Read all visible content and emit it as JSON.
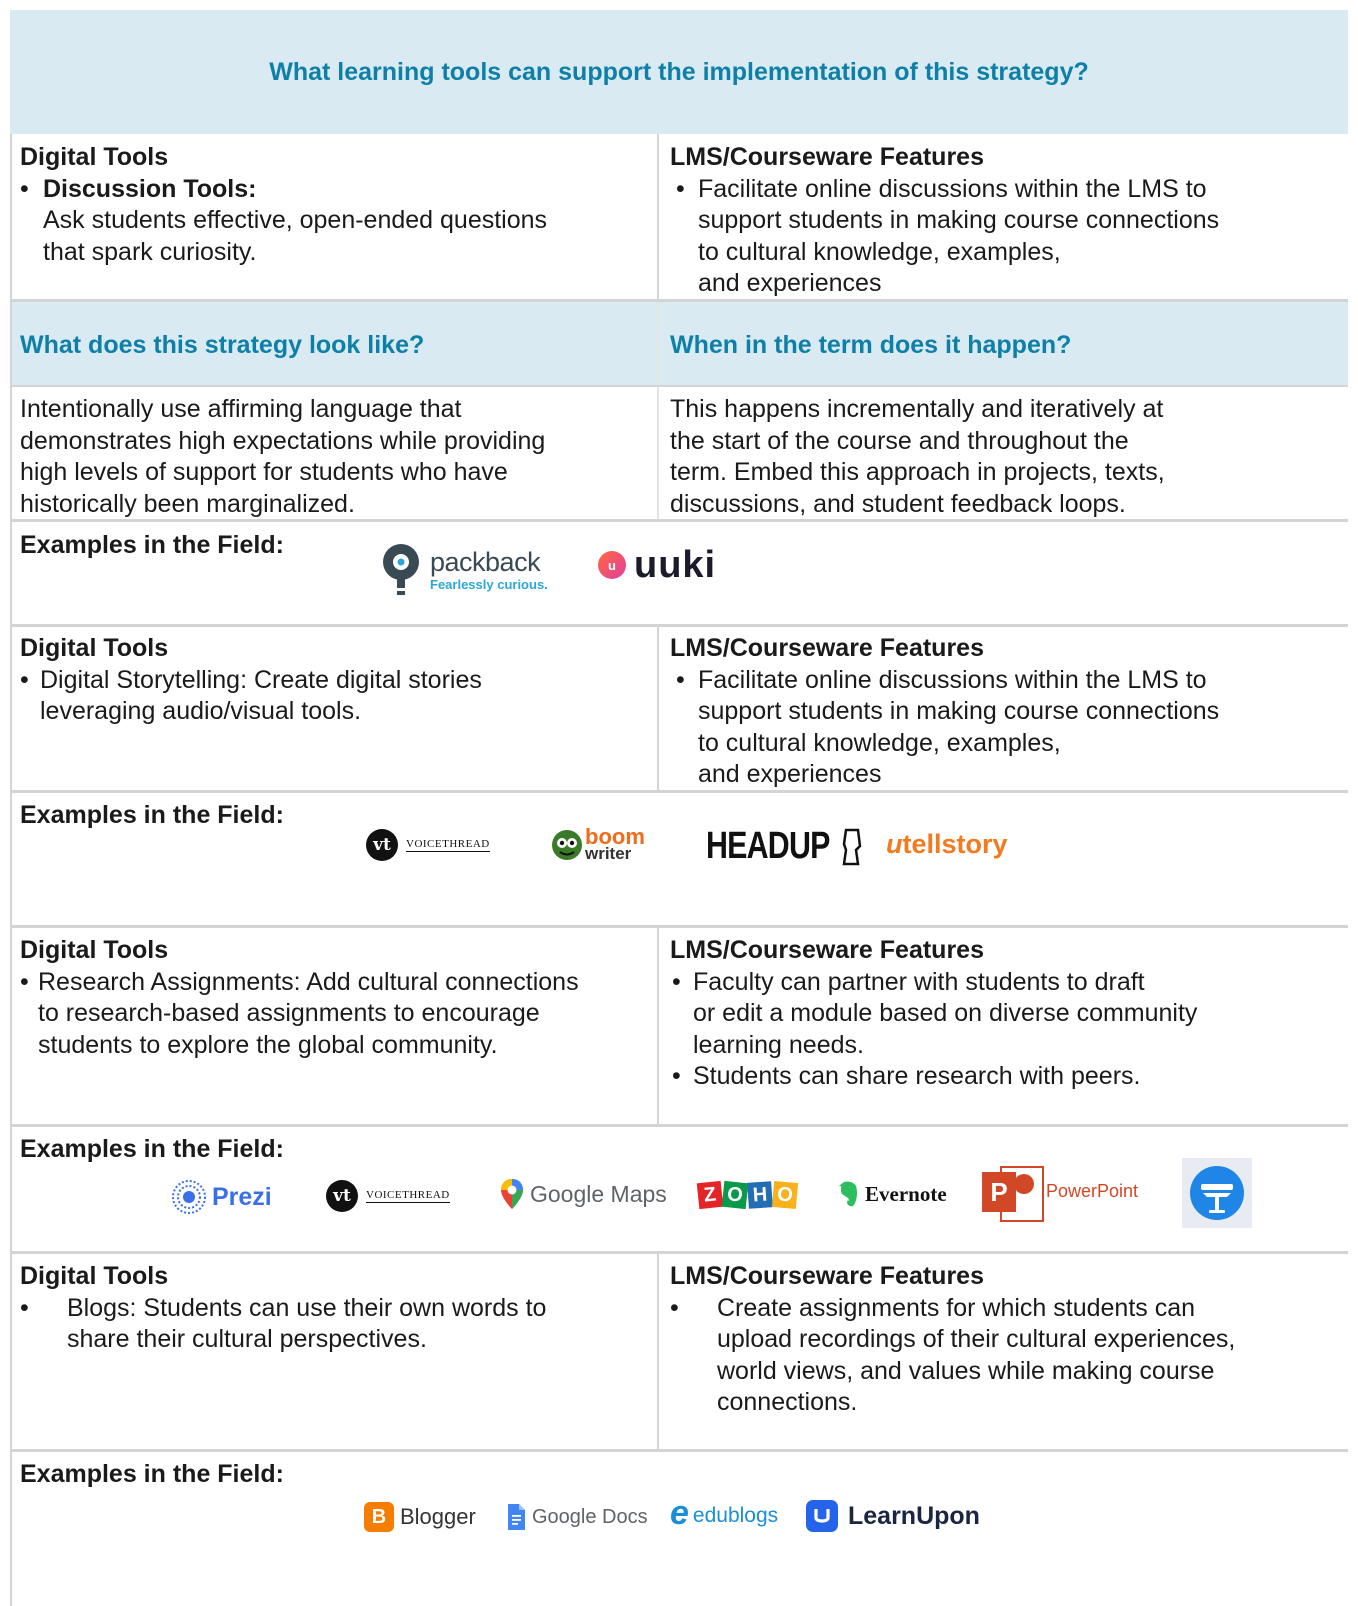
{
  "title": "What learning tools can support the implementation of this strategy?",
  "section1": {
    "left_header": "Digital Tools",
    "left_bullet_title": "Discussion Tools:",
    "left_bullet_text_1": "Ask students effective, open-ended questions",
    "left_bullet_text_2": "that spark curiosity.",
    "right_header": "LMS/Courseware Features",
    "right_lines": [
      "Facilitate online discussions within the LMS to",
      "support students in making course connections",
      "to cultural knowledge, examples,",
      "and experiences"
    ]
  },
  "questions": {
    "left": "What does this strategy look like?",
    "right": "When in the term does it happen?"
  },
  "answers": {
    "left": [
      "Intentionally use affirming language that",
      "demonstrates high expectations while providing",
      "high levels of support for students who have",
      "historically been marginalized."
    ],
    "right": [
      "This happens incrementally and iteratively at",
      "the start of the course and throughout the",
      "term. Embed this approach in projects, texts,",
      "discussions, and student feedback loops."
    ]
  },
  "examples_label": "Examples in the Field:",
  "examples1": {
    "packback_name": "packback",
    "packback_tagline": "Fearlessly curious.",
    "uuki_name": "uuki"
  },
  "section2": {
    "left_header": "Digital Tools",
    "left_lines": [
      "Digital Storytelling: Create digital stories",
      "leveraging audio/visual tools."
    ],
    "right_header": "LMS/Courseware Features",
    "right_lines": [
      "Facilitate online discussions within the LMS to",
      "support students in making course connections",
      "to cultural knowledge, examples,",
      "and experiences"
    ]
  },
  "examples2": {
    "voicethread_mark": "vt",
    "voicethread_name": "VOICETHREAD",
    "boom_top": "boom",
    "boom_bottom": "writer",
    "headup": "HEADUP",
    "utellstory_u": "u",
    "utellstory_rest_1": "tell",
    "utellstory_rest_2": "story"
  },
  "section3": {
    "left_header": "Digital Tools",
    "left_lines": [
      "Research Assignments: Add cultural connections",
      "to research-based assignments to encourage",
      "students to explore the global community."
    ],
    "right_header": "LMS/Courseware Features",
    "right_bullet1": [
      "Faculty can partner with students to draft",
      "or edit a module based on diverse community",
      "learning needs."
    ],
    "right_bullet2": "Students can share research with peers."
  },
  "examples3": {
    "prezi": "Prezi",
    "voicethread_mark": "vt",
    "voicethread_name": "VOICETHREAD",
    "google_maps": "Google Maps",
    "zoho_letters": [
      "Z",
      "O",
      "H",
      "O"
    ],
    "evernote": "Evernote",
    "powerpoint_letter": "P",
    "powerpoint": "PowerPoint"
  },
  "section4": {
    "left_header": "Digital Tools",
    "left_lines": [
      "Blogs: Students can use their own words to",
      "share their cultural perspectives."
    ],
    "right_header": "LMS/Courseware Features",
    "right_lines": [
      "Create assignments for which students can",
      "upload recordings of their cultural experiences,",
      "world views, and values while making course",
      "connections."
    ]
  },
  "examples4": {
    "blogger_letter": "B",
    "blogger": "Blogger",
    "google_docs": "Google Docs",
    "edublogs_e": "e",
    "edublogs": "edublogs",
    "learnupon": "LearnUpon"
  },
  "colors": {
    "band": "#d9eaf3",
    "teal": "#0e7fa6",
    "rule": "#d4d4d4"
  }
}
